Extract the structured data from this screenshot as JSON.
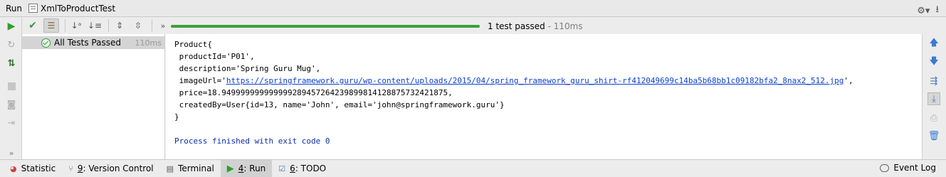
{
  "title_bar": {
    "run_label": "Run",
    "config_name": "XmlToProductTest",
    "settings_icon": "gear-icon",
    "hide_icon": "hide-panel-icon"
  },
  "colors": {
    "progress": "#3ca03c",
    "link": "#0b3fcf",
    "exit_text": "#0b2fa8",
    "time_gray": "#808080"
  },
  "test_toolbar": {
    "status_text": "1 test passed",
    "status_time": " - 110ms",
    "progress_fraction": 1.0
  },
  "test_tree": {
    "root_label": "All Tests Passed",
    "root_time": "110ms"
  },
  "console": {
    "lines": [
      "Product{",
      " productId='P01',",
      " description='Spring Guru Mug',",
      " imageUrl='",
      " price=18.949999999999999289457264239899814128875732421875,",
      " createdBy=User{id=13, name='John', email='john@springframework.guru'}",
      "}",
      "Process finished with exit code 0"
    ],
    "image_url": "https://springframework.guru/wp-content/uploads/2015/04/spring_framework_guru_shirt-rf412049699c14ba5b68bb1c09182bfa2_8nax2_512.jpg",
    "image_url_suffix": "',"
  },
  "status_bar": {
    "tabs": [
      {
        "num": "",
        "label": "Statistic"
      },
      {
        "num": "9",
        "label": ": Version Control"
      },
      {
        "num": "",
        "label": "Terminal"
      },
      {
        "num": "4",
        "label": ": Run"
      },
      {
        "num": "6",
        "label": ": TODO"
      }
    ],
    "event_log": "Event Log"
  }
}
